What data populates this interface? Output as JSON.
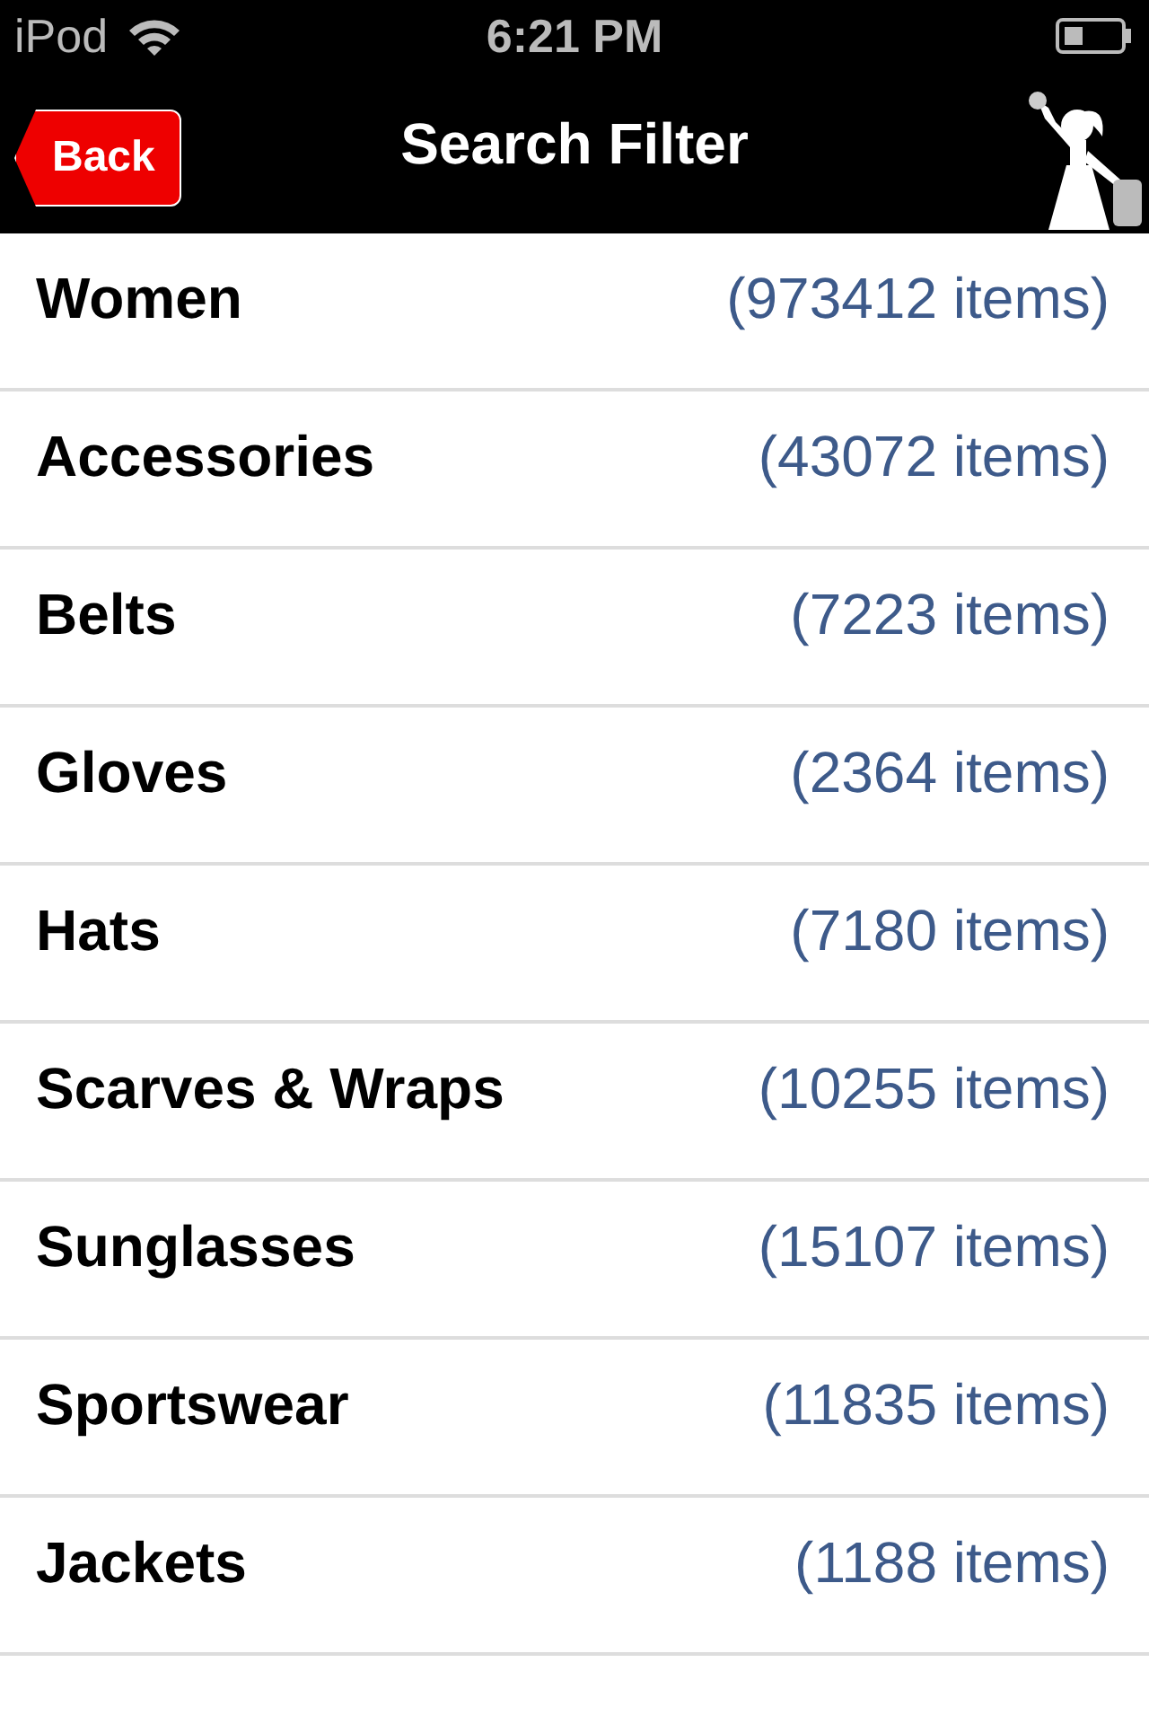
{
  "status_bar": {
    "carrier": "iPod",
    "time": "6:21 PM"
  },
  "nav_bar": {
    "back": "Back",
    "title": "Search Filter"
  },
  "categories": [
    {
      "name": "Women",
      "count": "(973412 items)"
    },
    {
      "name": "Accessories",
      "count": "(43072 items)"
    },
    {
      "name": "Belts",
      "count": "(7223 items)"
    },
    {
      "name": "Gloves",
      "count": "(2364 items)"
    },
    {
      "name": "Hats",
      "count": "(7180 items)"
    },
    {
      "name": "Scarves & Wraps",
      "count": "(10255 items)"
    },
    {
      "name": "Sunglasses",
      "count": "(15107 items)"
    },
    {
      "name": "Sportswear",
      "count": "(11835 items)"
    },
    {
      "name": "Jackets",
      "count": "(1188 items)"
    }
  ]
}
